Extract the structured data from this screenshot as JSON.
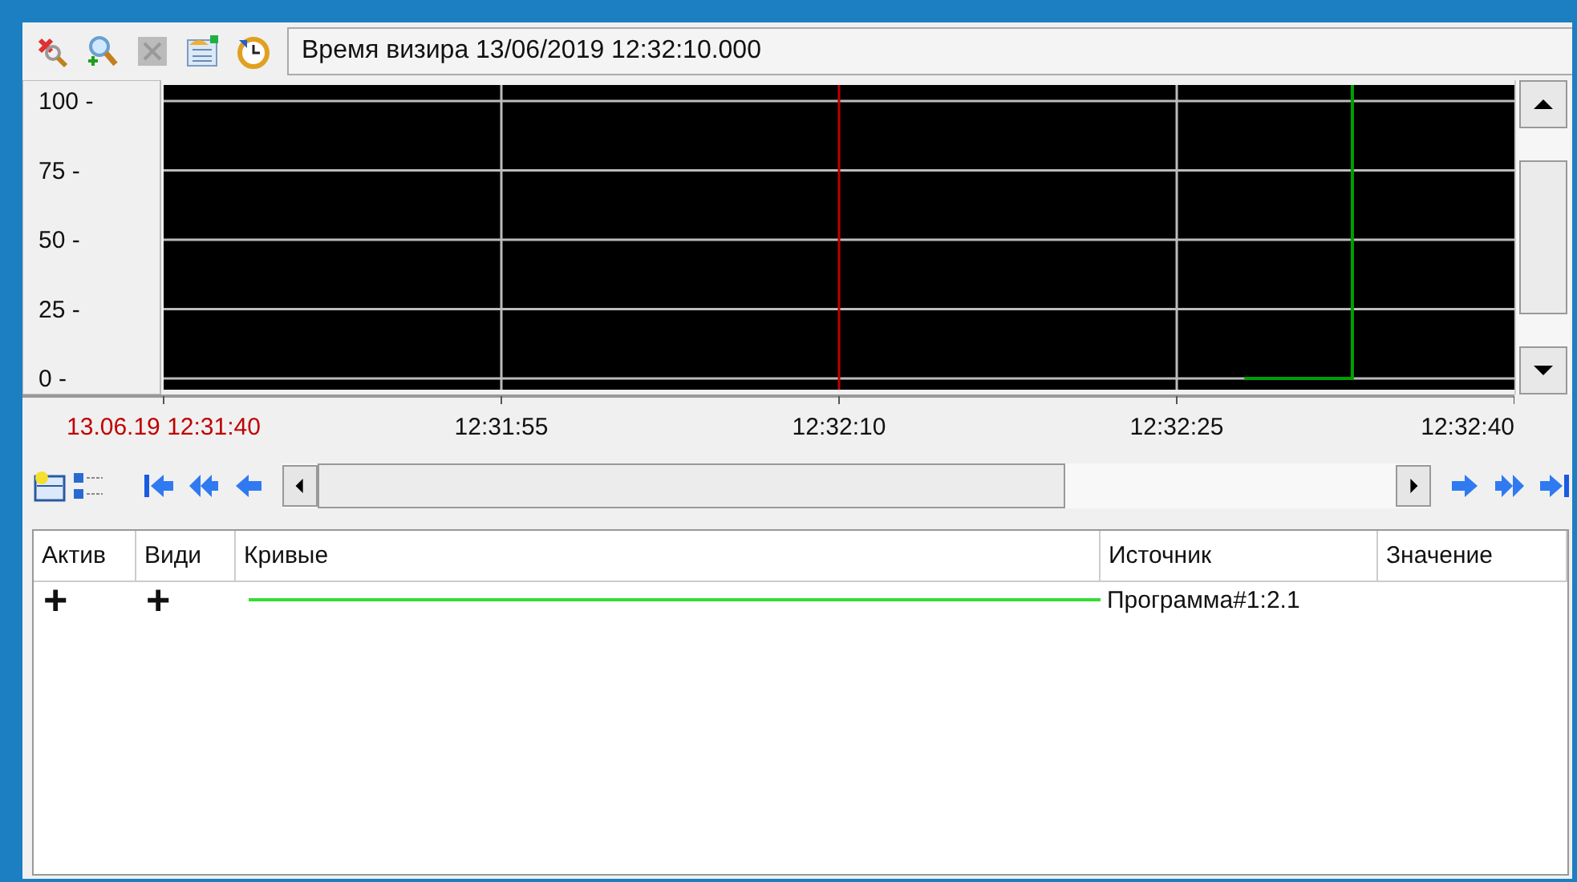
{
  "toolbar": {
    "visor_time": "Время визира 13/06/2019 12:32:10.000"
  },
  "chart": {
    "y_labels": [
      "100 -",
      "75 -",
      "50 -",
      "25 -",
      "0 -"
    ],
    "time_labels": [
      "13.06.19 12:31:40",
      "12:31:55",
      "12:32:10",
      "12:32:25",
      "12:32:40"
    ]
  },
  "table": {
    "columns": [
      "Актив",
      "Види",
      "Кривые",
      "Источник",
      "Значение"
    ],
    "rows": [
      {
        "active": "+",
        "visible": "+",
        "color": "#33dd33",
        "source": "Программа#1:2.1"
      }
    ]
  }
}
